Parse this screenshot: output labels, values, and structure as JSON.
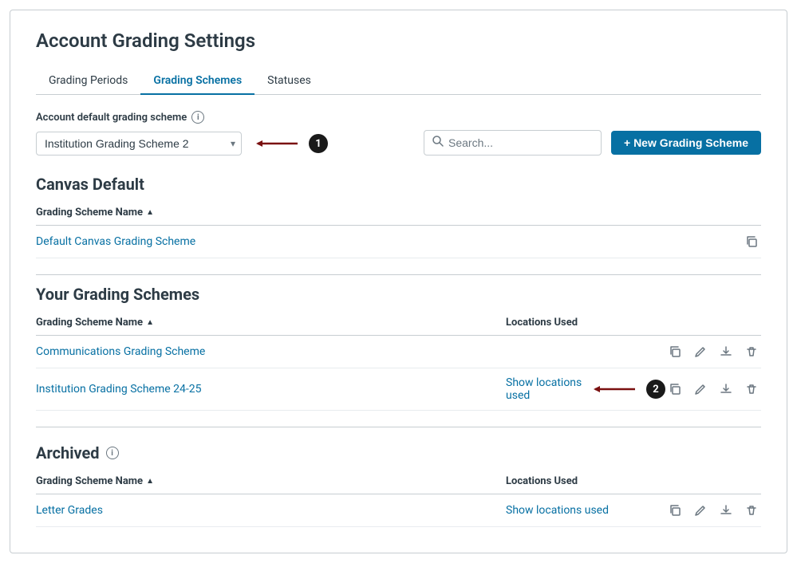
{
  "page": {
    "title": "Account Grading Settings",
    "tabs": [
      {
        "id": "grading-periods",
        "label": "Grading Periods",
        "active": false
      },
      {
        "id": "grading-schemes",
        "label": "Grading Schemes",
        "active": true
      },
      {
        "id": "statuses",
        "label": "Statuses",
        "active": false
      }
    ],
    "defaultScheme": {
      "label": "Account default grading scheme",
      "selectedValue": "Institution Grading Scheme 2",
      "options": [
        "Institution Grading Scheme 2",
        "Default Canvas Grading Scheme",
        "Communications Grading Scheme",
        "Institution Grading Scheme 24-25",
        "Letter Grades"
      ]
    },
    "search": {
      "placeholder": "Search..."
    },
    "newSchemeBtn": "+ New Grading Scheme",
    "canvasDefault": {
      "sectionTitle": "Canvas Default",
      "columnHeader": "Grading Scheme Name",
      "rows": [
        {
          "name": "Default Canvas Grading Scheme",
          "link": true
        }
      ]
    },
    "yourSchemes": {
      "sectionTitle": "Your Grading Schemes",
      "columns": [
        "Grading Scheme Name",
        "Locations Used"
      ],
      "rows": [
        {
          "name": "Communications Grading Scheme",
          "locationsUsed": "",
          "showLocations": false
        },
        {
          "name": "Institution Grading Scheme 24-25",
          "locationsUsed": "Show locations used",
          "showLocations": true
        }
      ]
    },
    "archived": {
      "sectionTitle": "Archived",
      "columns": [
        "Grading Scheme Name",
        "Locations Used"
      ],
      "rows": [
        {
          "name": "Letter Grades",
          "locationsUsed": "Show locations used",
          "showLocations": true
        }
      ]
    },
    "annotations": {
      "bubble1": "1",
      "bubble2": "2"
    },
    "icons": {
      "copy": "⧉",
      "edit": "✎",
      "download": "⬇",
      "delete": "🗑",
      "search": "🔍"
    }
  }
}
